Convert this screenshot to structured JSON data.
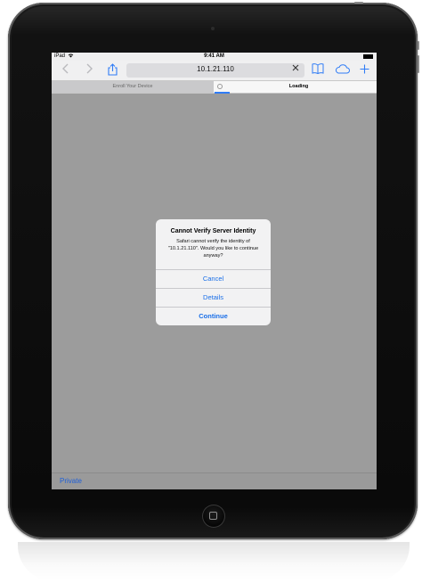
{
  "status": {
    "carrier": "iPad",
    "wifi_icon": "wifi-icon",
    "time": "9:41 AM",
    "battery_icon": "battery-icon"
  },
  "toolbar": {
    "back_icon": "chevron-left-icon",
    "forward_icon": "chevron-right-icon",
    "share_icon": "share-icon",
    "url": "10.1.21.110",
    "stop_icon": "close-icon",
    "bookmarks_icon": "book-icon",
    "icloud_icon": "cloud-icon",
    "new_tab_icon": "plus-icon"
  },
  "tabs": [
    {
      "label": "Enroll Your Device",
      "active": false
    },
    {
      "label": "Loading",
      "active": true
    }
  ],
  "alert": {
    "title": "Cannot Verify Server Identity",
    "message": "Safari cannot verify the identity of \"10.1.21.110\". Would you like to continue anyway?",
    "buttons": {
      "cancel": "Cancel",
      "details": "Details",
      "continue": "Continue"
    }
  },
  "bottom": {
    "private_label": "Private"
  },
  "colors": {
    "accent": "#2f7cf6",
    "dimmed_page": "#9c9c9c",
    "alert_bg": "#f2f2f3"
  }
}
